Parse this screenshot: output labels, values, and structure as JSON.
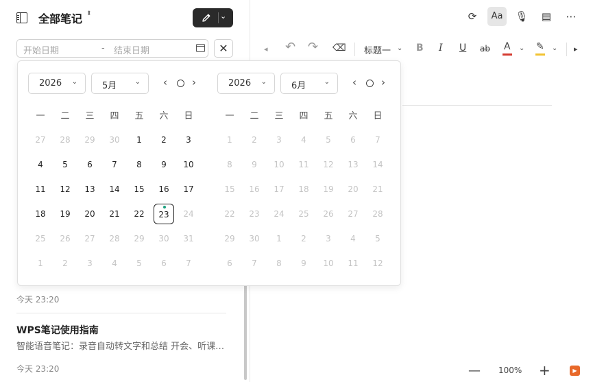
{
  "header": {
    "title": "全部笔记",
    "sort_glyph": "⬍",
    "new_note_chevron": "⌄"
  },
  "date_filter": {
    "start_placeholder": "开始日期",
    "separator": "-",
    "end_placeholder": "结束日期",
    "clear_glyph": "✕"
  },
  "notes": [
    {
      "time": "今天 23:20"
    },
    {
      "title": "WPS笔记使用指南",
      "snippet": "智能语音笔记：录音自动转文字和总结 开会、听课…",
      "time": "今天 23:20"
    }
  ],
  "top_toolbar": {
    "sync_glyph": "⟳",
    "font_label": "Aa",
    "mic_glyph": "🎙",
    "outline_glyph": "▤",
    "more_glyph": "⋯"
  },
  "format_toolbar": {
    "collapse_glyph": "◂",
    "undo_glyph": "↶",
    "redo_glyph": "↷",
    "clear_format_glyph": "⌫",
    "heading_label": "标题一",
    "heading_chevron": "⌄",
    "bold": "B",
    "italic": "I",
    "underline": "U",
    "strike": "ab",
    "font_color": "A",
    "font_color_chevron": "⌄",
    "font_color_swatch": "#d43a2f",
    "highlight_glyph": "✎",
    "highlight_chevron": "⌄",
    "highlight_swatch": "#f2c230",
    "expand_glyph": "▸"
  },
  "zoom": {
    "minus": "—",
    "value": "100%",
    "plus": "+",
    "badge": "▶"
  },
  "picker": {
    "weekdays": [
      "一",
      "二",
      "三",
      "四",
      "五",
      "六",
      "日"
    ],
    "left": {
      "year": "2026",
      "month": "5月",
      "weeks": [
        [
          "27",
          "28",
          "29",
          "30",
          "1",
          "2",
          "3"
        ],
        [
          "4",
          "5",
          "6",
          "7",
          "8",
          "9",
          "10"
        ],
        [
          "11",
          "12",
          "13",
          "14",
          "15",
          "16",
          "17"
        ],
        [
          "18",
          "19",
          "20",
          "21",
          "22",
          "23",
          "24"
        ],
        [
          "25",
          "26",
          "27",
          "28",
          "29",
          "30",
          "31"
        ],
        [
          "1",
          "2",
          "3",
          "4",
          "5",
          "6",
          "7"
        ]
      ],
      "dim": [
        [
          1,
          1,
          1,
          1,
          0,
          0,
          0
        ],
        [
          0,
          0,
          0,
          0,
          0,
          0,
          0
        ],
        [
          0,
          0,
          0,
          0,
          0,
          0,
          0
        ],
        [
          0,
          0,
          0,
          0,
          0,
          0,
          1
        ],
        [
          1,
          1,
          1,
          1,
          1,
          1,
          1
        ],
        [
          1,
          1,
          1,
          1,
          1,
          1,
          1
        ]
      ],
      "today": [
        3,
        5
      ]
    },
    "right": {
      "year": "2026",
      "month": "6月",
      "weeks": [
        [
          "1",
          "2",
          "3",
          "4",
          "5",
          "6",
          "7"
        ],
        [
          "8",
          "9",
          "10",
          "11",
          "12",
          "13",
          "14"
        ],
        [
          "15",
          "16",
          "17",
          "18",
          "19",
          "20",
          "21"
        ],
        [
          "22",
          "23",
          "24",
          "25",
          "26",
          "27",
          "28"
        ],
        [
          "29",
          "30",
          "1",
          "2",
          "3",
          "4",
          "5"
        ],
        [
          "6",
          "7",
          "8",
          "9",
          "10",
          "11",
          "12"
        ]
      ],
      "dim": [
        [
          1,
          1,
          1,
          1,
          1,
          1,
          1
        ],
        [
          1,
          1,
          1,
          1,
          1,
          1,
          1
        ],
        [
          1,
          1,
          1,
          1,
          1,
          1,
          1
        ],
        [
          1,
          1,
          1,
          1,
          1,
          1,
          1
        ],
        [
          1,
          1,
          1,
          1,
          1,
          1,
          1
        ],
        [
          1,
          1,
          1,
          1,
          1,
          1,
          1
        ]
      ],
      "today": null
    },
    "nav": {
      "prev": "‹",
      "next": "›",
      "select_chevron": "⌄"
    }
  }
}
